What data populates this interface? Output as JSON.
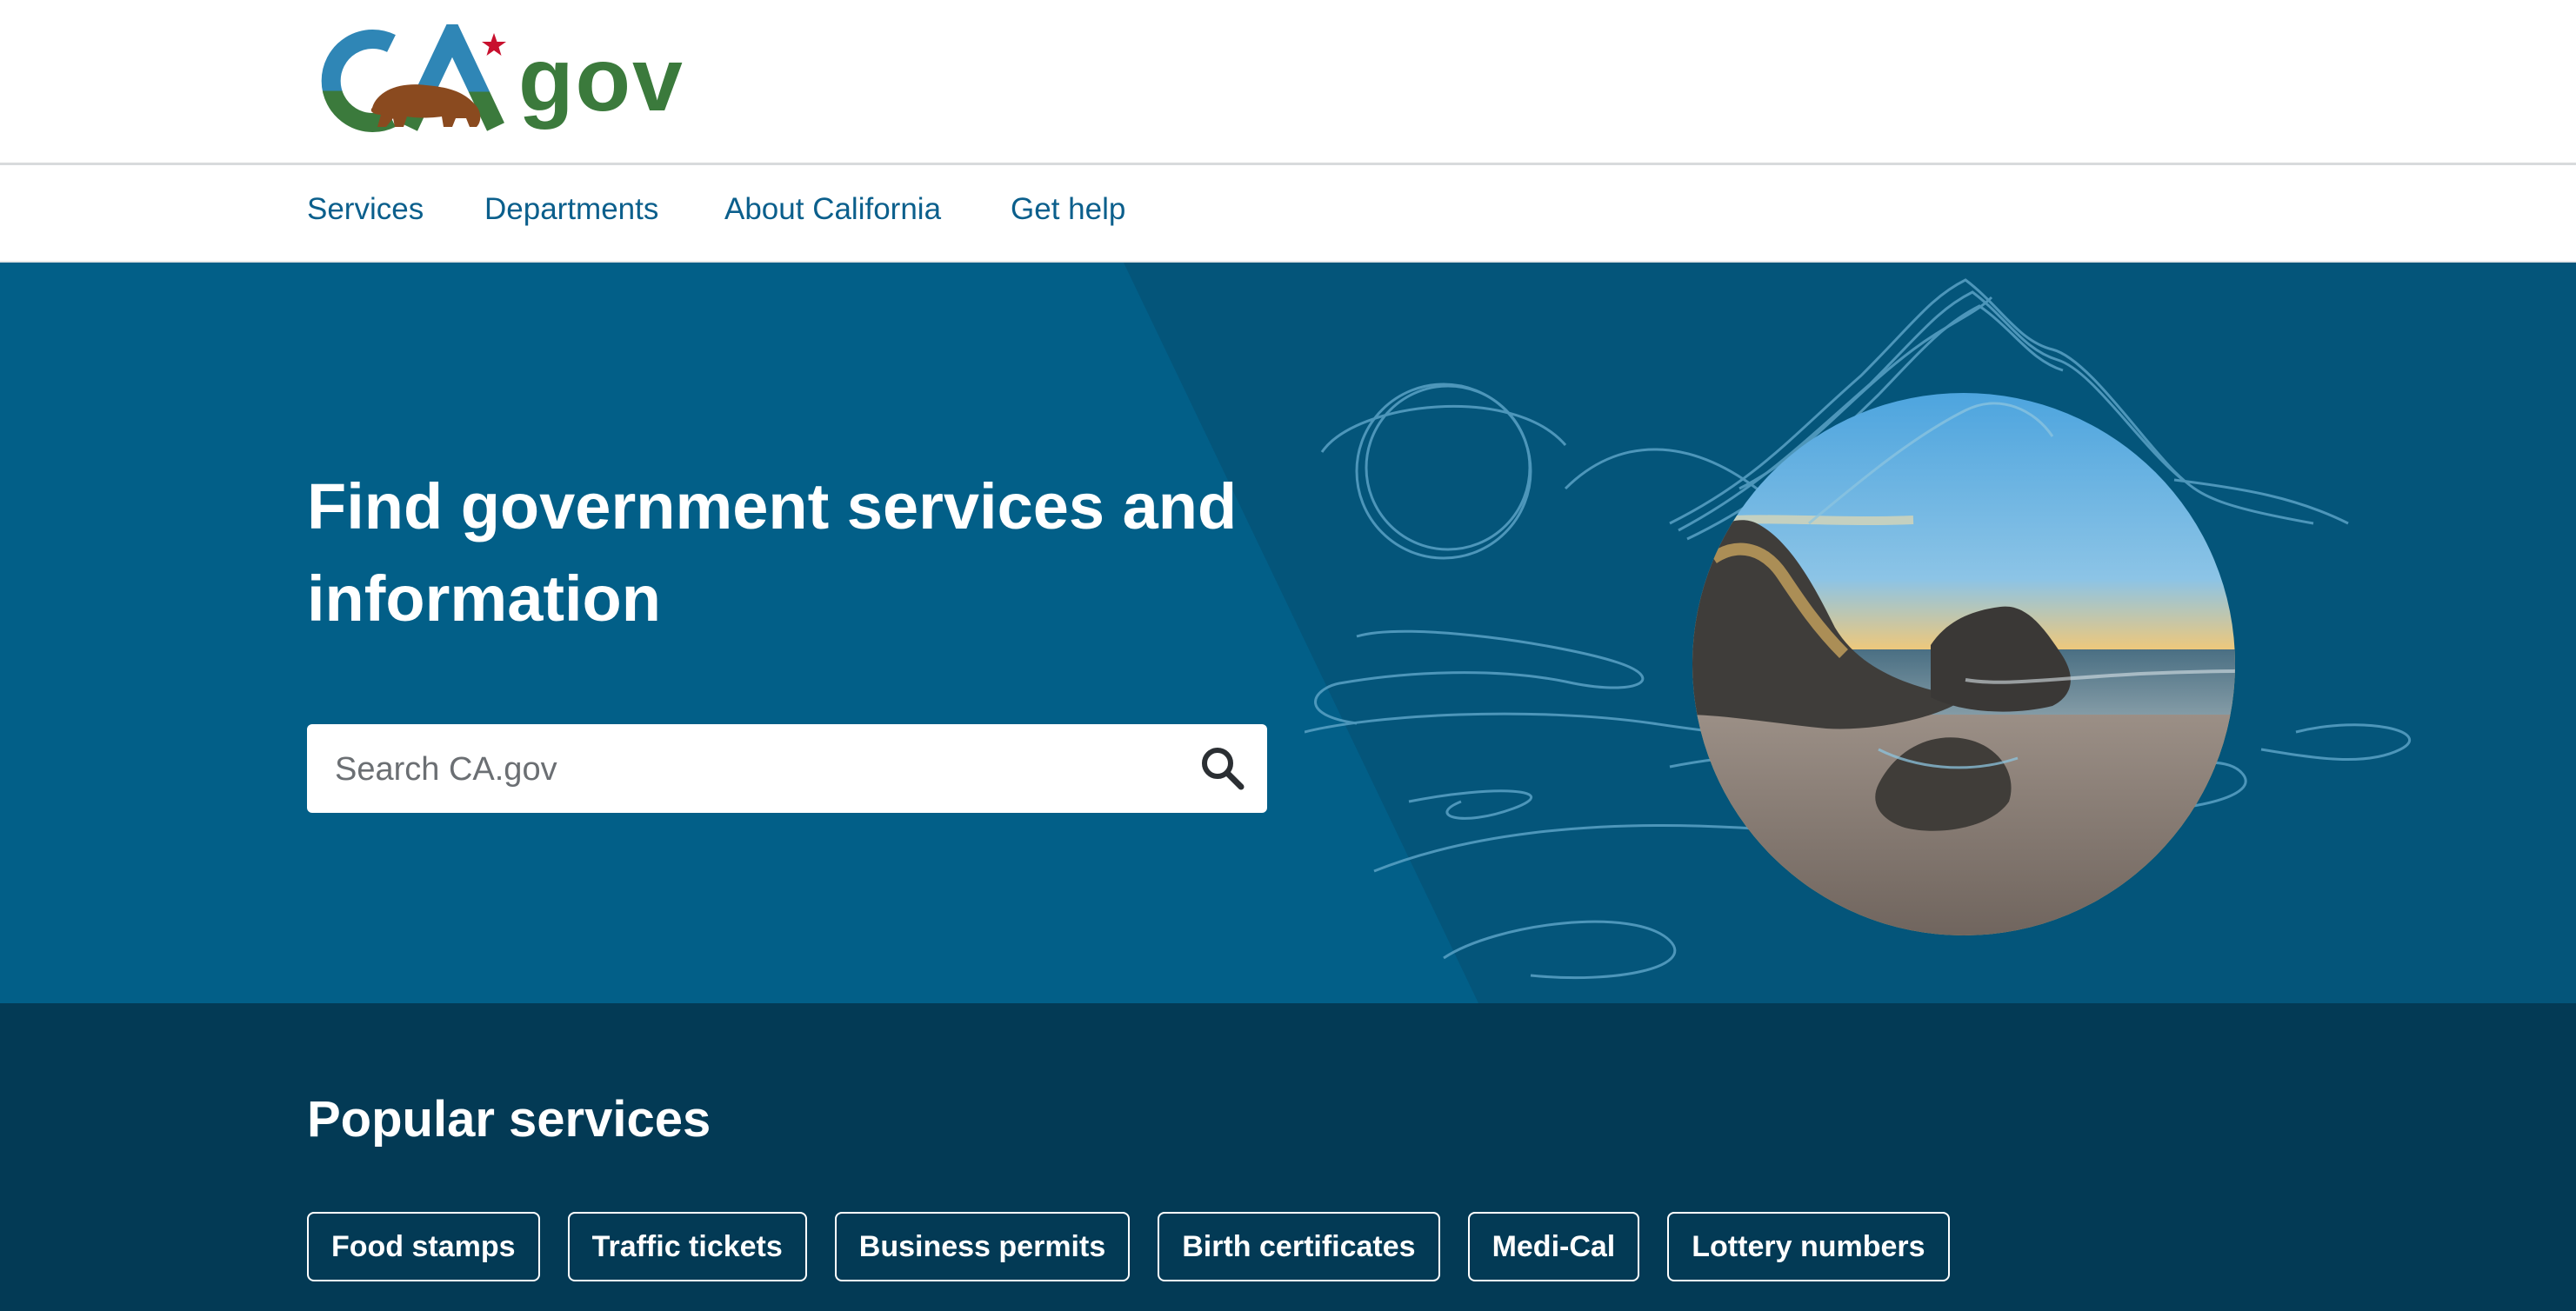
{
  "header": {
    "logo_text": "CA.gov",
    "logo_suffix": "gov",
    "brand_colors": {
      "blue": "#2f86b6",
      "green": "#3b7a3c",
      "bear": "#8a4a1f",
      "star": "#c8102e"
    }
  },
  "nav": {
    "items": [
      {
        "label": "Services"
      },
      {
        "label": "Departments"
      },
      {
        "label": "About California"
      },
      {
        "label": "Get help"
      }
    ]
  },
  "hero": {
    "title": "Find government services and information",
    "search": {
      "placeholder": "Search CA.gov",
      "value": "",
      "icon": "search-icon"
    },
    "colors": {
      "background": "#04557a",
      "panel": "#025f88"
    }
  },
  "popular": {
    "title": "Popular services",
    "items": [
      {
        "label": "Food stamps"
      },
      {
        "label": "Traffic tickets"
      },
      {
        "label": "Business permits"
      },
      {
        "label": "Birth certificates"
      },
      {
        "label": "Medi-Cal"
      },
      {
        "label": "Lottery numbers"
      }
    ],
    "colors": {
      "background": "#033a55"
    }
  }
}
